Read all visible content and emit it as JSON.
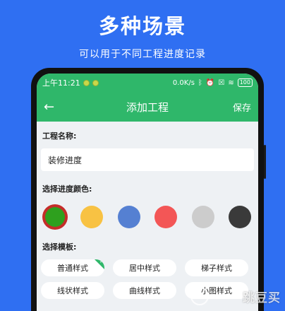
{
  "promo": {
    "headline": "多种场景",
    "subline": "可以用于不同工程进度记录"
  },
  "status_bar": {
    "time": "上午11:21",
    "speed": "0.0K/s",
    "icons": [
      "bluetooth-icon",
      "alarm-icon",
      "sim-icon",
      "wifi-icon"
    ],
    "battery": "100"
  },
  "app_bar": {
    "back_icon": "arrow-left-icon",
    "title": "添加工程",
    "save_label": "保存"
  },
  "form": {
    "name_label": "工程名称:",
    "name_value": "装修进度",
    "color_label": "选择进度颜色:",
    "colors": [
      "#2ea01e",
      "#f8c243",
      "#5580d2",
      "#f35656",
      "#cccccc",
      "#3a3a3a"
    ],
    "selected_color_index": 0,
    "template_label": "选择模板:",
    "templates": [
      "普通样式",
      "居中样式",
      "梯子样式",
      "线状样式",
      "曲线样式",
      "小图样式"
    ],
    "selected_template_index": 0
  },
  "watermark": "跳豆买",
  "theme": {
    "primary": "#2fb76a",
    "background": "#2f6ff2"
  }
}
